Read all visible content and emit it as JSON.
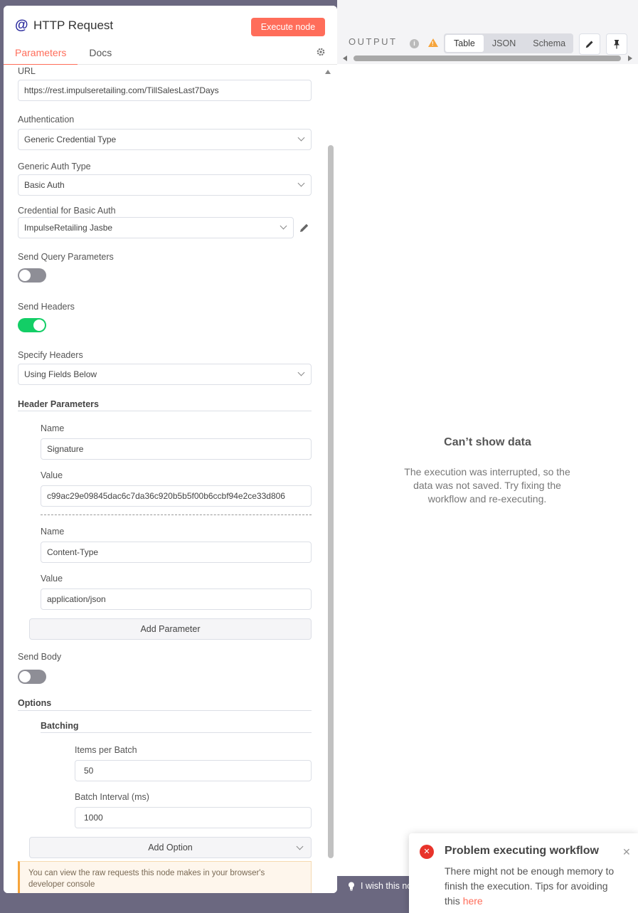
{
  "node": {
    "title": "HTTP Request",
    "execute_label": "Execute node",
    "tabs": [
      "Parameters",
      "Docs"
    ]
  },
  "params": {
    "url_label": "URL",
    "url_value": "https://rest.impulseretailing.com/TillSalesLast7Days",
    "auth_label": "Authentication",
    "auth_value": "Generic Credential Type",
    "gen_auth_label": "Generic Auth Type",
    "gen_auth_value": "Basic Auth",
    "cred_label": "Credential for Basic Auth",
    "cred_value": "ImpulseRetailing Jasbe",
    "send_query_label": "Send Query Parameters",
    "send_query_on": false,
    "send_headers_label": "Send Headers",
    "send_headers_on": true,
    "specify_headers_label": "Specify Headers",
    "specify_headers_value": "Using Fields Below",
    "header_params_title": "Header Parameters",
    "headers": [
      {
        "name_label": "Name",
        "name_value": "Signature",
        "value_label": "Value",
        "value_value": "c99ac29e09845dac6c7da36c920b5b5f00b6ccbf94e2ce33d806"
      },
      {
        "name_label": "Name",
        "name_value": "Content-Type",
        "value_label": "Value",
        "value_value": "application/json"
      }
    ],
    "add_parameter_label": "Add Parameter",
    "send_body_label": "Send Body",
    "send_body_on": false,
    "options_title": "Options",
    "batching_title": "Batching",
    "items_per_batch_label": "Items per Batch",
    "items_per_batch_value": "50",
    "batch_interval_label": "Batch Interval (ms)",
    "batch_interval_value": "1000",
    "add_option_label": "Add Option",
    "notice_text": "You can view the raw requests this node makes in your browser's developer console"
  },
  "output": {
    "label": "OUTPUT",
    "views": [
      "Table",
      "JSON",
      "Schema"
    ],
    "active_view": "Table",
    "empty_title": "Can’t show data",
    "empty_message": "The execution was interrupted, so the data was not saved. Try fixing the workflow and re-executing."
  },
  "footer": {
    "wish_text": "I wish this no"
  },
  "toast": {
    "title": "Problem executing workflow",
    "message": "There might not be enough memory to finish the execution. Tips for avoiding this",
    "link": "here"
  },
  "colors": {
    "accent": "#ff6d5a",
    "toggle_on": "#13ce66",
    "error": "#e8332a",
    "warning": "#f6a43b"
  },
  "icons": [
    "at-icon",
    "gear-icon",
    "chevron-down-icon",
    "pencil-icon",
    "info-icon",
    "warning-icon",
    "pin-icon",
    "lightbulb-icon",
    "error-icon",
    "close-icon"
  ]
}
